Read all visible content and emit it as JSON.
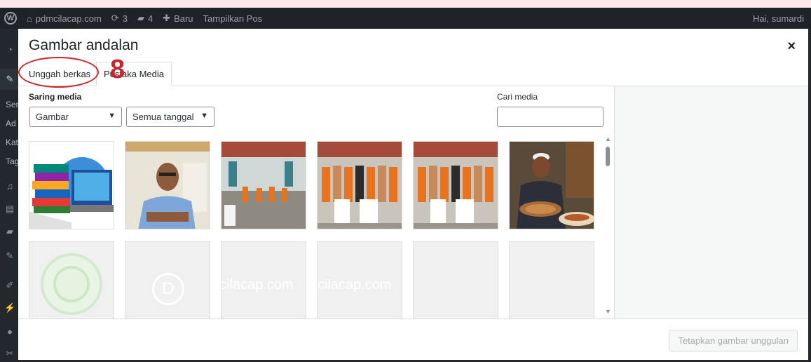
{
  "admin_bar": {
    "site_name": "pdmcilacap.com",
    "updates_count": "3",
    "comments_count": "4",
    "new_label": "Baru",
    "view_post_label": "Tampilkan Pos",
    "greeting": "Hai, sumardi"
  },
  "sidebar": {
    "texts": [
      "Ser",
      "Ad",
      "Kat",
      "Tag"
    ]
  },
  "modal": {
    "title": "Gambar andalan",
    "close": "×",
    "tabs": {
      "upload": "Unggah berkas",
      "library": "Pustaka Media"
    },
    "annotation": "8",
    "filter_label": "Saring media",
    "type_select": "Gambar",
    "date_select": "Semua tanggal",
    "search_label": "Cari media",
    "search_value": "",
    "watermark_1": "cilacap.com",
    "watermark_2": "cilacap.com",
    "logo_letter": "D",
    "set_button": "Tetapkan gambar unggulan"
  },
  "colors": {
    "annotation_red": "#c9252b",
    "admin_bar": "#1d2327"
  },
  "icons": [
    "wordpress-icon",
    "home-icon",
    "updates-icon",
    "comments-icon",
    "plus-icon",
    "close-icon",
    "chevron-down-icon"
  ]
}
